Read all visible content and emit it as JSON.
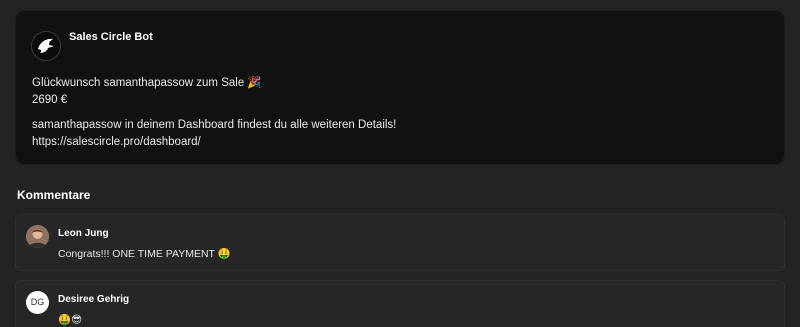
{
  "post": {
    "author": "Sales Circle Bot",
    "line1": "Glückwunsch samanthapassow zum Sale 🎉",
    "line2": "2690 €",
    "line3": "samanthapassow in deinem Dashboard findest du alle weiteren Details!",
    "link": "https://salescircle.pro/dashboard/"
  },
  "comments_section": {
    "title": "Kommentare"
  },
  "comments": [
    {
      "author": "Leon Jung",
      "text": "Congrats!!! ONE TIME PAYMENT 🤑"
    },
    {
      "author": "Desiree Gehrig",
      "avatar_initials": "DG",
      "text": "🤑😎"
    }
  ],
  "colors": {
    "background": "#232323",
    "card": "#111111",
    "comment_card": "#262626",
    "text": "#f2f2f2"
  }
}
